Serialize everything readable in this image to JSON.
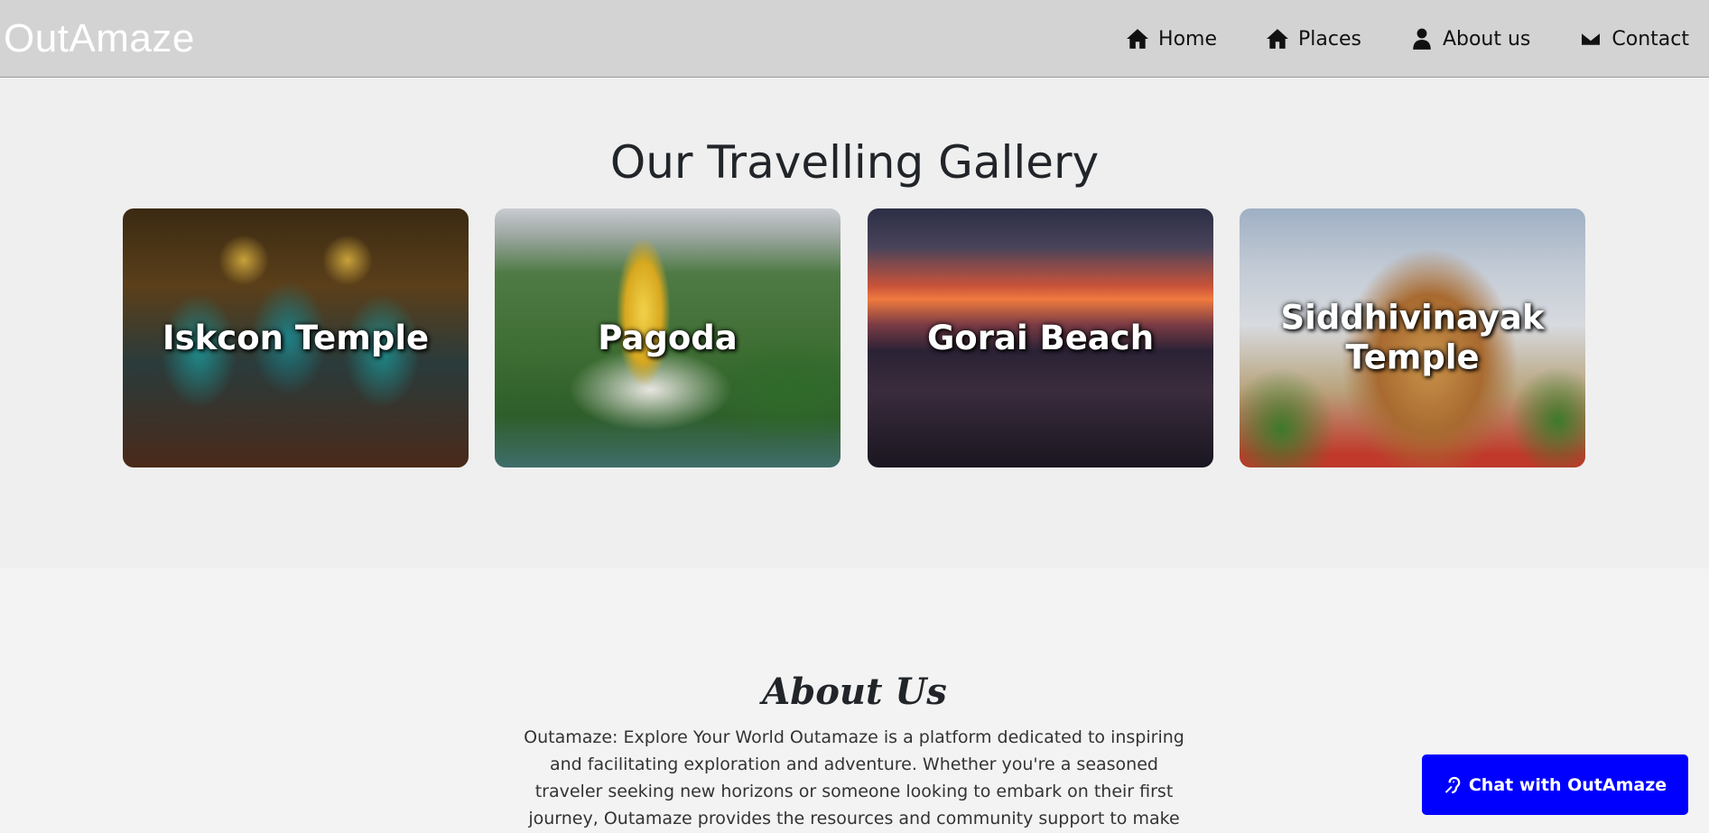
{
  "navbar": {
    "brand": "OutAmaze",
    "links": [
      {
        "label": "Home",
        "icon": "home-icon"
      },
      {
        "label": "Places",
        "icon": "home-icon"
      },
      {
        "label": "About us",
        "icon": "user-icon"
      },
      {
        "label": "Contact",
        "icon": "envelope-icon"
      }
    ],
    "background": "#d3d3d3"
  },
  "gallery": {
    "title": "Our Travelling Gallery",
    "cards": [
      {
        "label": "Iskcon Temple"
      },
      {
        "label": "Pagoda"
      },
      {
        "label": "Gorai Beach"
      },
      {
        "label": "Siddhivinayak Temple"
      }
    ]
  },
  "about": {
    "title": "About Us",
    "text": "Outamaze: Explore Your World Outamaze is a platform dedicated to inspiring and facilitating exploration and adventure. Whether you're a seasoned traveler seeking new horizons or someone looking to embark on their first journey, Outamaze provides the resources and community support to make every trip unforgettable."
  },
  "chat": {
    "label": "Chat with OutAmaze",
    "icon": "assistive-listening-icon",
    "color": "#0000ff"
  }
}
